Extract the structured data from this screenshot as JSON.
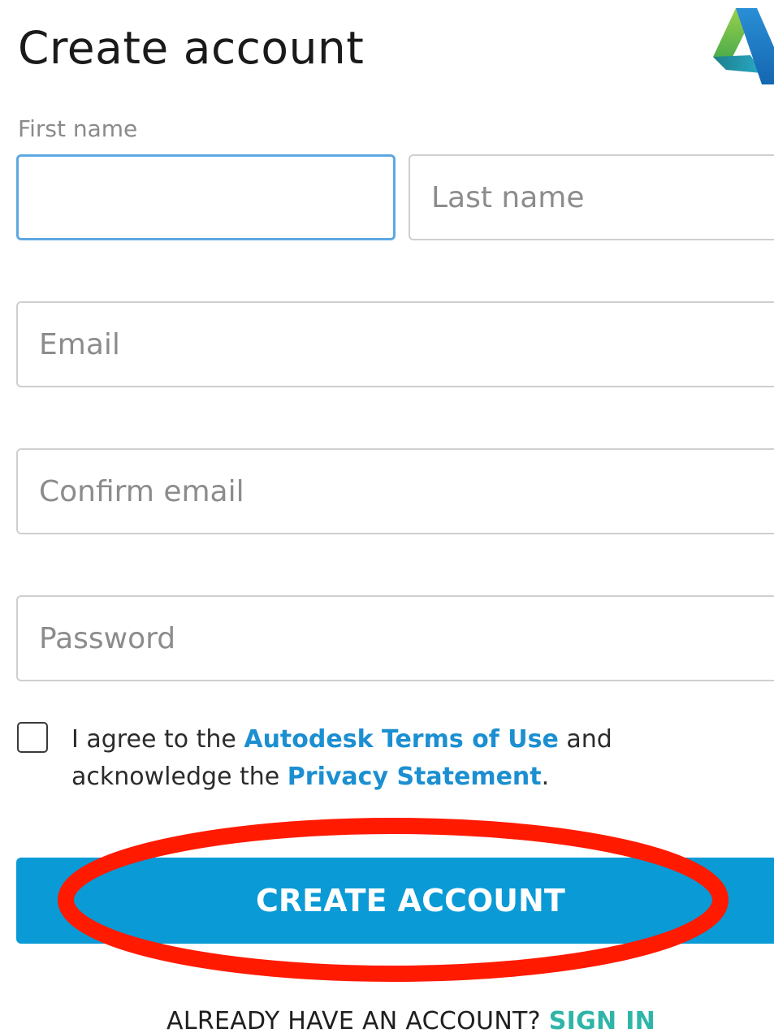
{
  "header": {
    "title": "Create account"
  },
  "form": {
    "first_name": {
      "label": "First name",
      "value": "",
      "placeholder": ""
    },
    "last_name": {
      "placeholder": "Last name"
    },
    "email": {
      "placeholder": "Email"
    },
    "confirm_email": {
      "placeholder": "Confirm email"
    },
    "password": {
      "placeholder": "Password"
    },
    "agreement": {
      "checked": false,
      "text_1": "I agree to the ",
      "terms_link": "Autodesk Terms of Use",
      "text_2": " and acknowledge the ",
      "privacy_link": "Privacy Statement",
      "text_3": "."
    },
    "submit_label": "CREATE ACCOUNT"
  },
  "footer": {
    "prompt": "ALREADY HAVE AN ACCOUNT? ",
    "signin_label": "SIGN IN"
  },
  "colors": {
    "accent": "#0a9ad6",
    "link": "#1c8fd1",
    "signin": "#2fb5a8",
    "focus_border": "#5ea8e2",
    "annotation": "#ff1a00"
  },
  "icons": {
    "logo": "autodesk-logo-icon"
  }
}
